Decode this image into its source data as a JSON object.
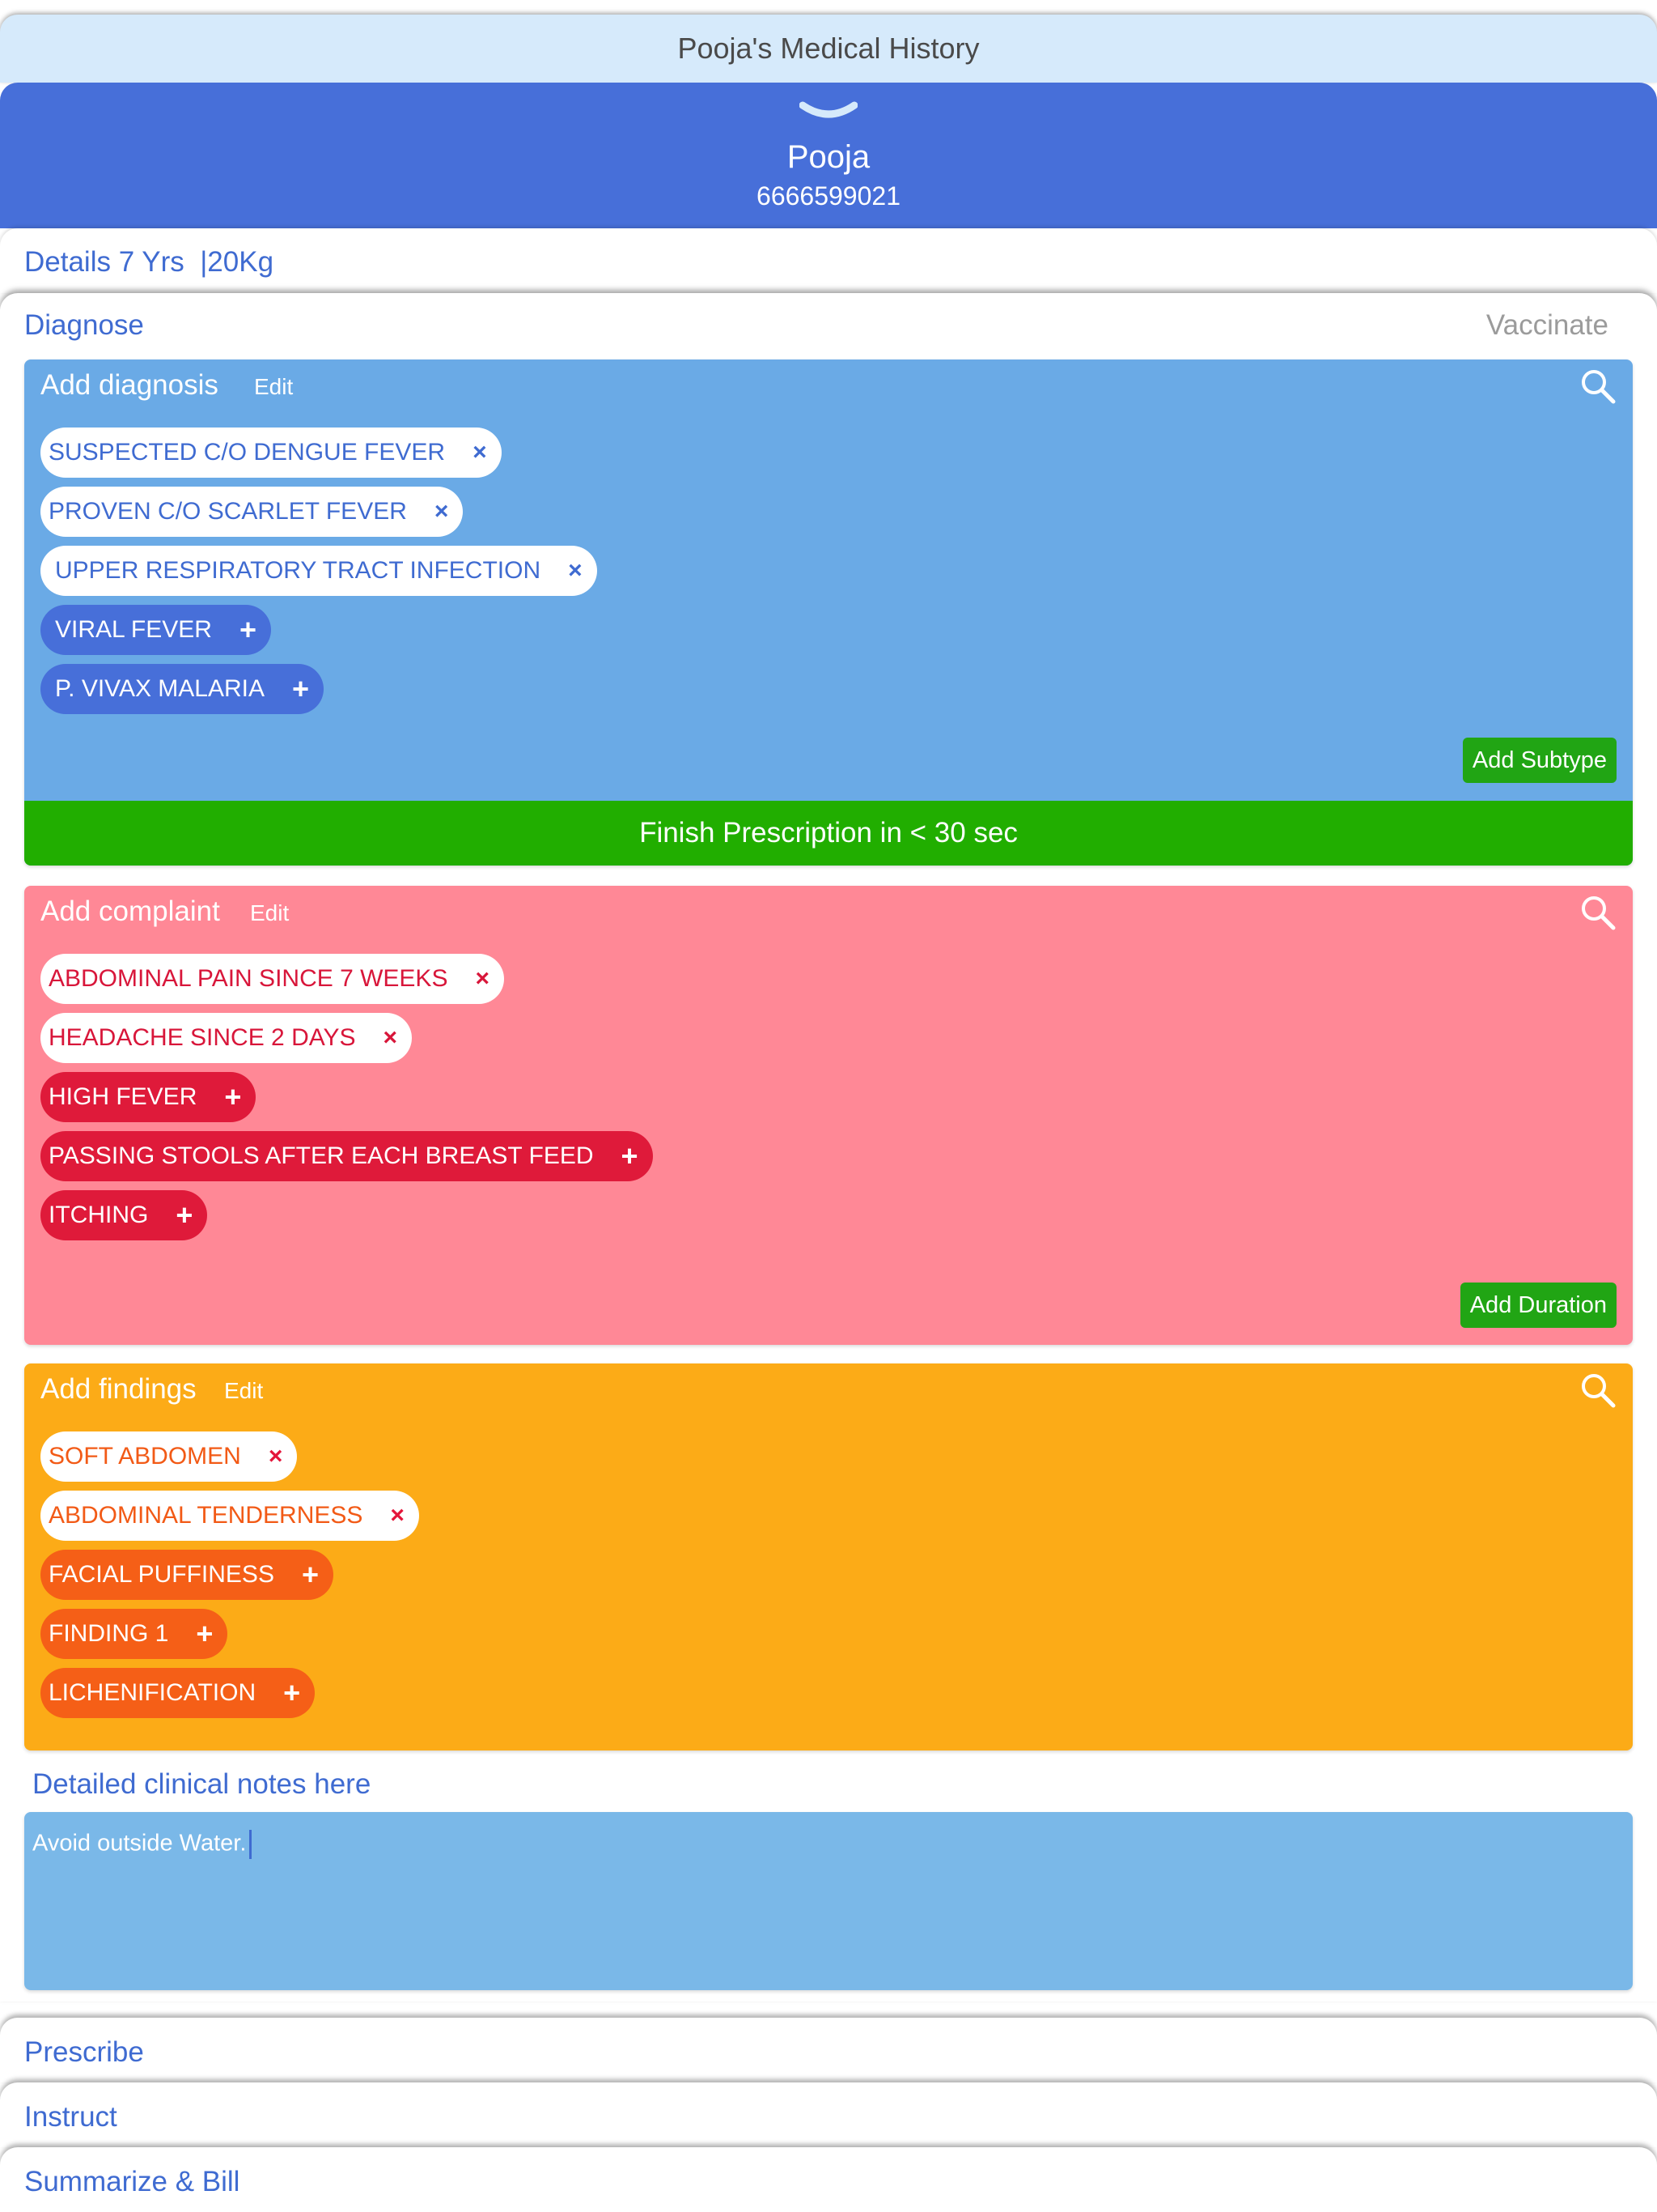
{
  "history_bar": {
    "title": "Pooja's Medical History"
  },
  "patient": {
    "name": "Pooja",
    "phone": "6666599021"
  },
  "details": {
    "label": "Details 7 Yrs  |20Kg"
  },
  "tabs": {
    "diagnose": "Diagnose",
    "vaccinate": "Vaccinate"
  },
  "diagnosis": {
    "title": "Add diagnosis",
    "edit_label": "Edit",
    "selected": [
      "SUSPECTED C/O DENGUE FEVER",
      "PROVEN C/O SCARLET FEVER",
      "UPPER RESPIRATORY TRACT INFECTION"
    ],
    "suggested": [
      "VIRAL FEVER",
      "P. VIVAX MALARIA"
    ],
    "add_subtype_label": "Add Subtype",
    "finish_label": "Finish Prescription in < 30 sec"
  },
  "complaint": {
    "title": "Add complaint",
    "edit_label": "Edit",
    "selected": [
      "ABDOMINAL PAIN SINCE 7 WEEKS",
      "HEADACHE SINCE 2 DAYS"
    ],
    "suggested": [
      "HIGH FEVER",
      "PASSING STOOLS AFTER EACH BREAST FEED",
      "ITCHING"
    ],
    "add_duration_label": "Add Duration"
  },
  "findings": {
    "title": "Add findings",
    "edit_label": "Edit",
    "selected": [
      "SOFT ABDOMEN",
      "ABDOMINAL TENDERNESS"
    ],
    "suggested": [
      "FACIAL PUFFINESS",
      "FINDING 1",
      "LICHENIFICATION"
    ]
  },
  "notes": {
    "label": "Detailed clinical notes here",
    "value": "Avoid outside Water."
  },
  "bottom_sections": {
    "prescribe": "Prescribe",
    "instruct": "Instruct",
    "summarize": "Summarize & Bill"
  },
  "icons": {
    "remove": "×",
    "add": "+",
    "search": "search-icon",
    "collapse": "chevron-down-icon"
  },
  "colors": {
    "header_blue": "#476fd9",
    "diagnosis_panel": "#6aaae6",
    "complaint_panel": "#ff8896",
    "findings_panel": "#fcab17",
    "notes_box": "#7ab8e8",
    "action_green": "#21a514"
  }
}
